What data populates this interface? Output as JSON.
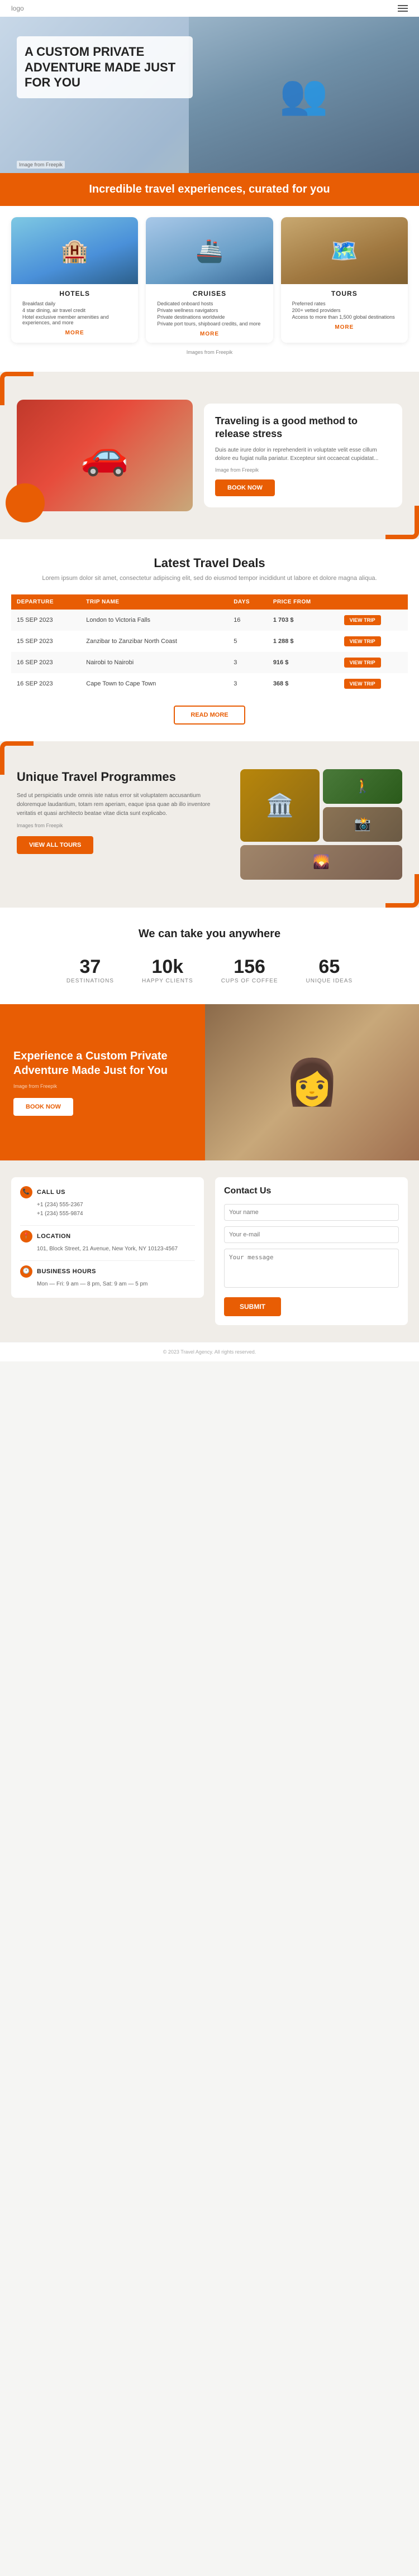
{
  "header": {
    "logo": "logo",
    "menu_icon": "≡"
  },
  "hero": {
    "title": "A CUSTOM PRIVATE ADVENTURE MADE JUST FOR YOU",
    "image_credit": "Image from Freepik"
  },
  "orange_banner": {
    "text": "Incredible travel experiences, curated for you"
  },
  "cards_section": {
    "image_credit": "Images from Freepik",
    "hotels": {
      "title": "HOTELS",
      "more": "MORE",
      "features": [
        "Breakfast daily",
        "4 star dining, air travel credit",
        "Hotel exclusive member amenities and experiences, and more"
      ]
    },
    "cruises": {
      "title": "CRUISES",
      "more": "MORE",
      "features": [
        "Dedicated onboard hosts",
        "Private wellness navigators",
        "Private destinations worldwide",
        "Private port tours, shipboard credits, and more"
      ]
    },
    "tours": {
      "title": "TOURS",
      "more": "MORE",
      "features": [
        "Preferred rates",
        "200+ vetted providers",
        "Access to more than 1,500 global destinations"
      ]
    }
  },
  "travel_stress": {
    "title": "Traveling is a good method to release stress",
    "body": "Duis aute irure dolor in reprehenderit in voluptate velit esse cillum dolore eu fugiat nulla pariatur. Excepteur sint occaecat cupidatat...",
    "image_credit": "Image from Freepik",
    "button": "BOOK NOW"
  },
  "travel_deals": {
    "title": "Latest Travel Deals",
    "subtitle": "Lorem ipsum dolor sit amet, consectetur adipiscing elit, sed do eiusmod tempor incididunt ut labore et dolore magna aliqua.",
    "more_button": "READ MORE",
    "table": {
      "headers": [
        "DEPARTURE",
        "TRIP NAME",
        "DAYS",
        "PRICE FROM"
      ],
      "rows": [
        {
          "departure": "15 SEP 2023",
          "trip": "London to Victoria Falls",
          "days": "16",
          "price": "1 703 $",
          "view": "VIEW TRIP"
        },
        {
          "departure": "15 SEP 2023",
          "trip": "Zanzibar to Zanzibar North Coast",
          "days": "5",
          "price": "1 288 $",
          "view": "VIEW TRIP"
        },
        {
          "departure": "16 SEP 2023",
          "trip": "Nairobi to Nairobi",
          "days": "3",
          "price": "916 $",
          "view": "VIEW TRIP"
        },
        {
          "departure": "16 SEP 2023",
          "trip": "Cape Town to Cape Town",
          "days": "3",
          "price": "368 $",
          "view": "VIEW TRIP"
        }
      ]
    }
  },
  "programmes": {
    "title": "Unique Travel Programmes",
    "body": "Sed ut perspiciatis unde omnis iste natus error sit voluptatem accusantium doloremque laudantium, totam rem aperiam, eaque ipsa quae ab illo inventore veritatis et quasi architecto beatae vitae dicta sunt explicabo.",
    "image_credit": "Images from Freepik",
    "button": "VIEW ALL TOURS"
  },
  "stats": {
    "title": "We can take you anywhere",
    "items": [
      {
        "number": "37",
        "label": "DESTINATIONS"
      },
      {
        "number": "10k",
        "label": "HAPPY CLIENTS"
      },
      {
        "number": "156",
        "label": "CUPS OF COFFEE"
      },
      {
        "number": "65",
        "label": "UNIQUE IDEAS"
      }
    ]
  },
  "adventure": {
    "title": "Experience a Custom Private Adventure Made Just for You",
    "image_credit": "Image from Freepik",
    "button": "BOOK NOW"
  },
  "contact": {
    "left": {
      "call_us": {
        "label": "CALL US",
        "detail": "+1 (234) 555-2367\n+1 (234) 555-9874"
      },
      "location": {
        "label": "LOCATION",
        "detail": "101, Block Street, 21 Avenue, New York, NY 10123-4567"
      },
      "business_hours": {
        "label": "BUSINESS HOURS",
        "detail": "Mon — Fri: 9 am — 8 pm, Sat: 9 am — 5 pm"
      }
    },
    "right": {
      "title": "Contact Us",
      "name_placeholder": "Your name",
      "email_placeholder": "Your e-mail",
      "message_placeholder": "Your message",
      "submit": "SUBMIT"
    }
  },
  "footer": {
    "text": "© 2023 Travel Agency. All rights reserved."
  }
}
